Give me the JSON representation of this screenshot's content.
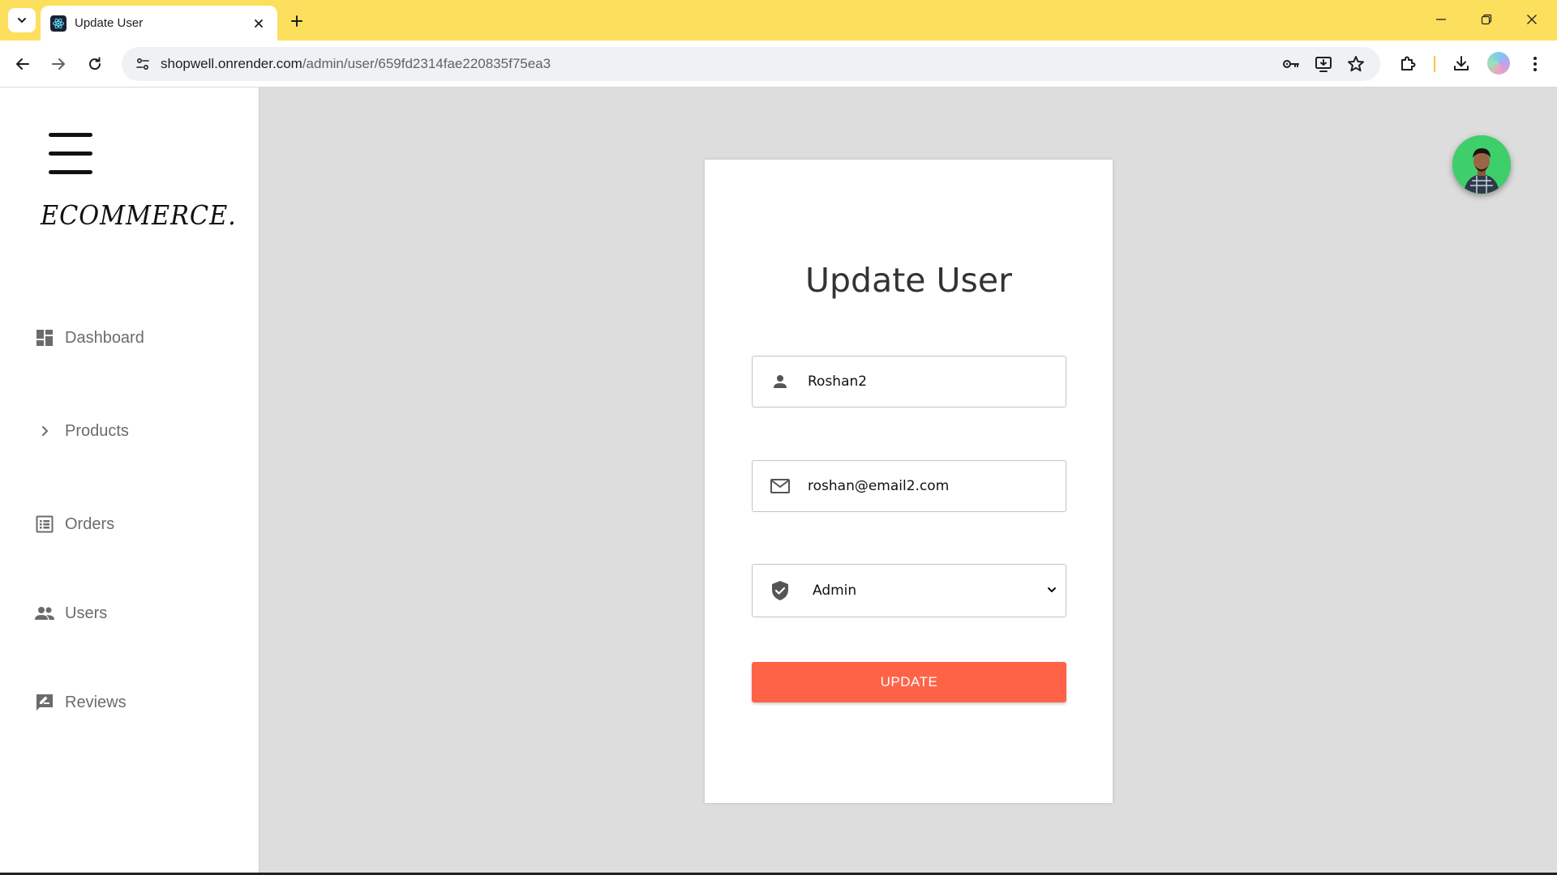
{
  "browser": {
    "tab_title": "Update User",
    "url_host": "shopwell.onrender.com",
    "url_path": "/admin/user/659fd2314fae220835f75ea3",
    "accent_color": "#fddf5e"
  },
  "sidebar": {
    "brand": "ECOMMERCE.",
    "items": [
      {
        "label": "Dashboard",
        "icon": "dashboard-icon"
      },
      {
        "label": "Products",
        "icon": "chevron-right-icon"
      },
      {
        "label": "Orders",
        "icon": "list-alt-icon"
      },
      {
        "label": "Users",
        "icon": "people-icon"
      },
      {
        "label": "Reviews",
        "icon": "rate-review-icon"
      }
    ]
  },
  "form": {
    "title": "Update User",
    "name_value": "Roshan2",
    "email_value": "roshan@email2.com",
    "role_value": "Admin",
    "submit_label": "UPDATE",
    "button_color": "#ff6347"
  }
}
